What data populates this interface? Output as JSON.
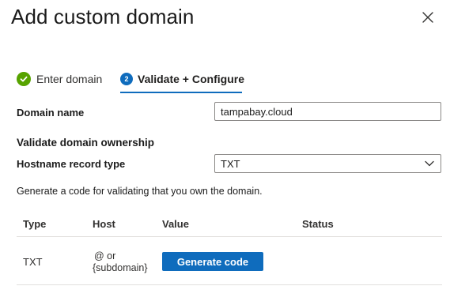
{
  "dialog": {
    "title": "Add custom domain"
  },
  "steps": [
    {
      "label": "Enter domain",
      "status": "complete"
    },
    {
      "label": "Validate + Configure",
      "number": "2",
      "status": "active"
    }
  ],
  "form": {
    "domain_name_label": "Domain name",
    "domain_name_value": "tampabay.cloud",
    "validate_section_title": "Validate domain ownership",
    "record_type_label": "Hostname record type",
    "record_type_value": "TXT",
    "description": "Generate a code for validating that you own the domain."
  },
  "table": {
    "headers": [
      "Type",
      "Host",
      "Value",
      "Status"
    ],
    "rows": [
      {
        "type": "TXT",
        "host_line1": "@ or",
        "host_line2": "{subdomain}",
        "value_button": "Generate code",
        "status": ""
      }
    ]
  },
  "colors": {
    "accent": "#0f6cbd",
    "success": "#57a300"
  },
  "icons": {
    "close": "close-icon",
    "step_complete": "checkmark-circle-icon",
    "dropdown": "chevron-down-icon"
  }
}
